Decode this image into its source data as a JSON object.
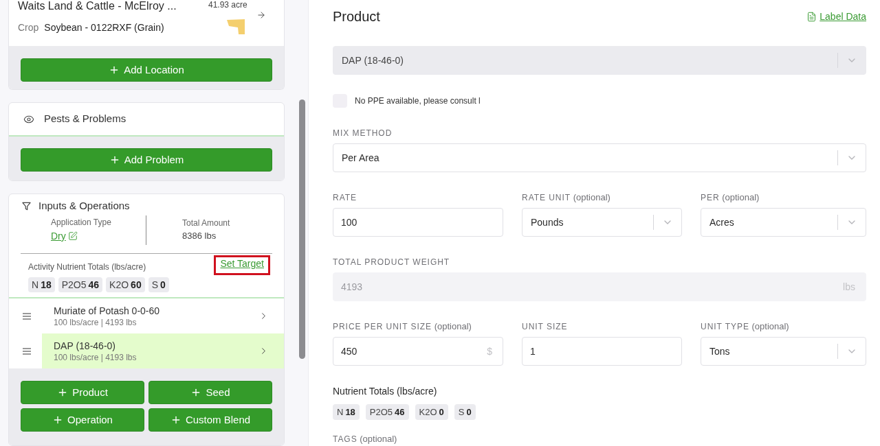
{
  "location_card": {
    "field_name": "Waits Land & Cattle - McElroy ...",
    "area": "41.93 acre",
    "crop_label": "Crop",
    "crop": "Soybean - 0122RXF (Grain)",
    "add_button": "Add Location"
  },
  "pests_card": {
    "title": "Pests & Problems",
    "add_button": "Add Problem"
  },
  "inputs_card": {
    "title": "Inputs & Operations",
    "application_type": {
      "label": "Application Type",
      "value": "Dry"
    },
    "total_amount": {
      "label": "Total Amount",
      "value": "8386 lbs"
    },
    "nutrient_totals": {
      "title": "Activity Nutrient Totals (lbs/acre)",
      "set_target": {
        "label": "Set Target",
        "highlighted": true
      },
      "chips": [
        {
          "name": "N",
          "value": "18"
        },
        {
          "name": "P2O5",
          "value": "46"
        },
        {
          "name": "K2O",
          "value": "60"
        },
        {
          "name": "S",
          "value": "0"
        }
      ]
    },
    "items": [
      {
        "name": "Muriate of Potash 0-0-60",
        "detail": "100 lbs/acre | 4193 lbs",
        "selected": false
      },
      {
        "name": "DAP (18-46-0)",
        "detail": "100 lbs/acre | 4193 lbs",
        "selected": true
      }
    ],
    "buttons": [
      "Product",
      "Seed",
      "Operation",
      "Custom Blend"
    ]
  },
  "product_form": {
    "title": "Product",
    "label_data": "Label Data",
    "product_select": {
      "kind": "select",
      "value": "DAP (18-46-0)",
      "disabled": true
    },
    "ppe_checkbox": {
      "label": "No PPE available, please consult l",
      "checked": false
    },
    "rows": [
      [
        {
          "kind": "select",
          "label": "MIX METHOD",
          "value": "Per Area",
          "disabled": false
        }
      ],
      [
        {
          "kind": "input",
          "label": "RATE",
          "value": "100",
          "disabled": false
        },
        {
          "kind": "select",
          "label": "RATE UNIT",
          "note": "(optional)",
          "value": "Pounds",
          "disabled": false
        },
        {
          "kind": "select",
          "label": "PER",
          "note": "(optional)",
          "value": "Acres",
          "disabled": false
        }
      ],
      [
        {
          "kind": "input",
          "label": "TOTAL PRODUCT WEIGHT",
          "value": "4193",
          "suffix": "lbs",
          "disabled": true
        }
      ],
      [
        {
          "kind": "input",
          "label": "PRICE PER UNIT SIZE",
          "note": "(optional)",
          "value": "450",
          "suffix": "$",
          "disabled": false
        },
        {
          "kind": "input",
          "label": "UNIT SIZE",
          "value": "1",
          "disabled": false
        },
        {
          "kind": "select",
          "label": "UNIT TYPE",
          "note": "(optional)",
          "value": "Tons",
          "disabled": false
        }
      ]
    ],
    "nutrient_totals": {
      "title": "Nutrient Totals (lbs/acre)",
      "chips": [
        {
          "name": "N",
          "value": "18"
        },
        {
          "name": "P2O5",
          "value": "46"
        },
        {
          "name": "K2O",
          "value": "0"
        },
        {
          "name": "S",
          "value": "0"
        }
      ]
    },
    "tags": {
      "label": "TAGS",
      "note": "(optional)"
    }
  }
}
